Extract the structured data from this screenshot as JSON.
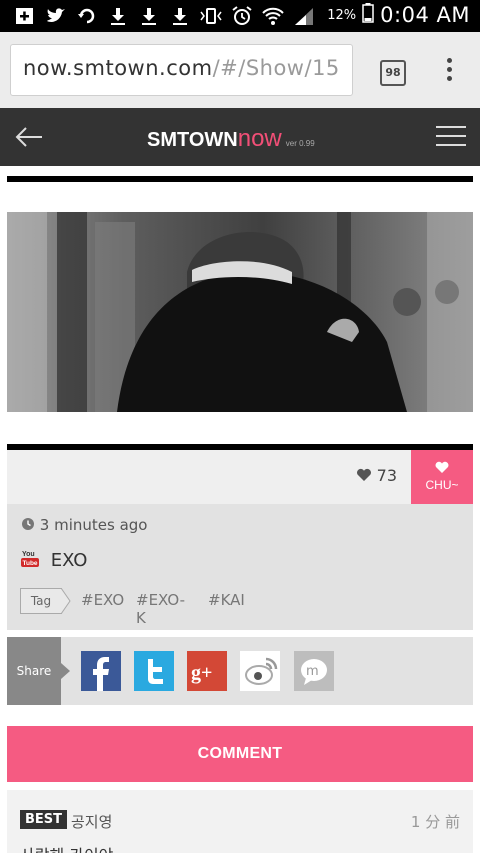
{
  "status_bar": {
    "battery": "12%",
    "time": "0:04 AM",
    "icons": [
      "add-box-icon",
      "twitter-icon",
      "sync-icon",
      "download-icon",
      "download-icon",
      "download-icon",
      "vibrate-icon",
      "alarm-icon",
      "wifi-icon",
      "signal-icon",
      "battery-icon"
    ]
  },
  "browser": {
    "url_main": "now.smtown.com",
    "url_rest": "/#/Show/15",
    "tab_count": "98"
  },
  "header": {
    "logo_main": "SMTOWN",
    "logo_now": "now",
    "version": "ver 0.99"
  },
  "post": {
    "likes": "73",
    "chu_label": "CHU~",
    "time": "3 minutes ago",
    "artist": "EXO",
    "youtube_top": "You",
    "youtube_bottom": "Tube",
    "tag_label": "Tag",
    "tags": [
      "#EXO",
      "#EXO-K",
      "#KAI"
    ]
  },
  "share": {
    "label": "Share",
    "gplus": "g+"
  },
  "comment_button": "COMMENT",
  "best_comment": {
    "badge": "BEST",
    "author": "공지영",
    "time": "1 分 前",
    "text": "사랑해 카이야"
  },
  "colors": {
    "accent_pink": "#f55b82",
    "header_bg": "#333333",
    "facebook": "#3b5998",
    "twitter": "#2aa9e0",
    "gplus": "#d34836"
  }
}
